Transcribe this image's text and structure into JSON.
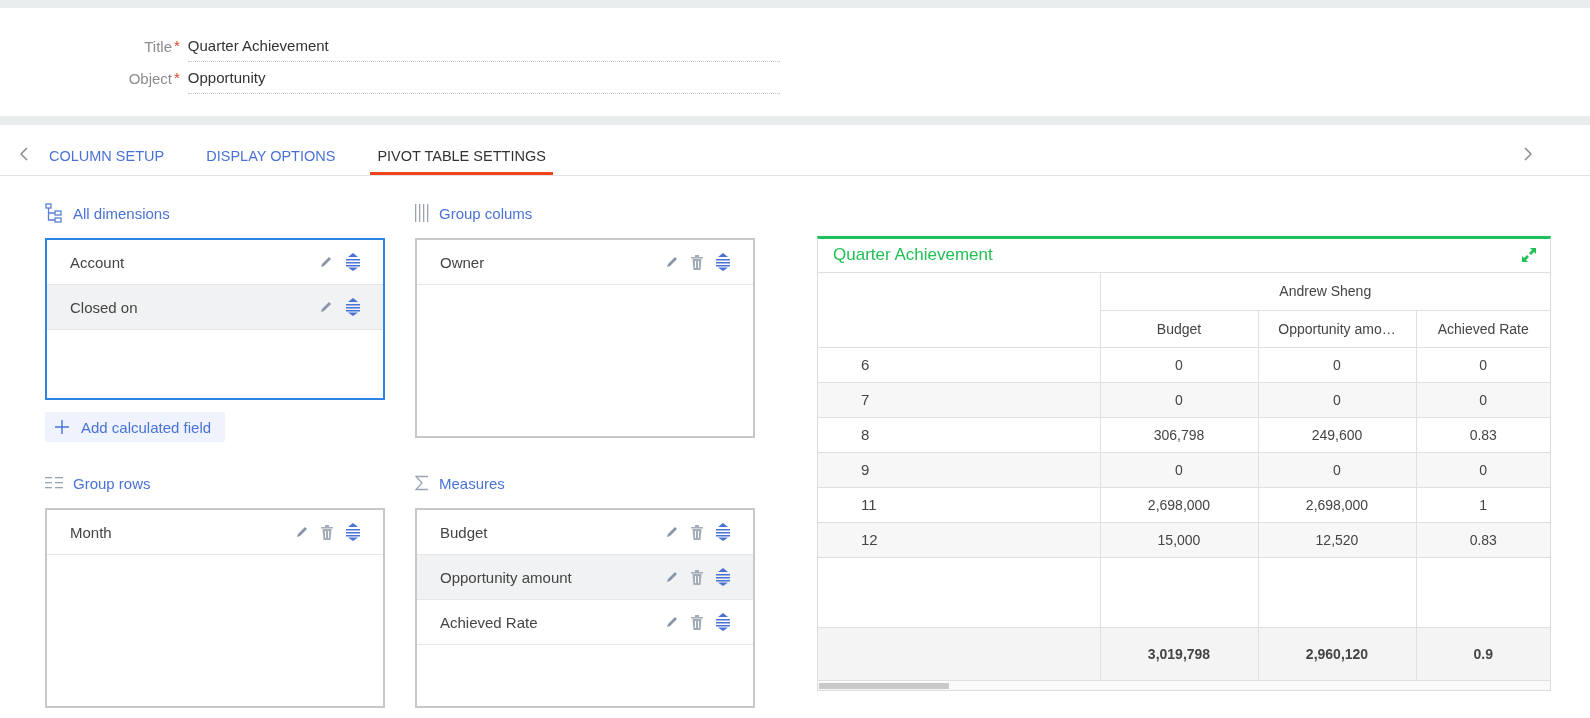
{
  "form": {
    "fields": [
      {
        "label": "Title",
        "mark": "*",
        "value": "Quarter Achievement"
      },
      {
        "label": "Object",
        "mark": "*",
        "value": "Opportunity"
      }
    ]
  },
  "tabs": [
    {
      "label": "COLUMN SETUP",
      "selected": false
    },
    {
      "label": "DISPLAY OPTIONS",
      "selected": false
    },
    {
      "label": "PIVOT TABLE SETTINGS",
      "selected": true
    }
  ],
  "sections": [
    {
      "kind": "dimensions",
      "title": "All dimensions",
      "focused": true,
      "removable": false,
      "items": [
        {
          "label": "Account",
          "highlighted": false
        },
        {
          "label": "Closed on",
          "highlighted": true
        }
      ],
      "add_button": "Add calculated field"
    },
    {
      "kind": "columns",
      "title": "Group colums",
      "focused": false,
      "removable": true,
      "items": [
        {
          "label": "Owner",
          "highlighted": false
        }
      ]
    },
    {
      "kind": "rows",
      "title": "Group rows",
      "focused": false,
      "removable": true,
      "items": [
        {
          "label": "Month",
          "highlighted": false
        }
      ]
    },
    {
      "kind": "measures",
      "title": "Measures",
      "focused": false,
      "removable": true,
      "items": [
        {
          "label": "Budget",
          "highlighted": false
        },
        {
          "label": "Opportunity amount",
          "highlighted": true
        },
        {
          "label": "Achieved Rate",
          "highlighted": false
        }
      ]
    }
  ],
  "pivot": {
    "title": "Quarter Achievement",
    "column_group": "Andrew Sheng",
    "columns": [
      "Budget",
      "Opportunity amo…",
      "Achieved Rate"
    ],
    "rows": [
      {
        "label": "6",
        "cells": [
          "0",
          "0",
          "0"
        ]
      },
      {
        "label": "7",
        "cells": [
          "0",
          "0",
          "0"
        ]
      },
      {
        "label": "8",
        "cells": [
          "306,798",
          "249,600",
          "0.83"
        ]
      },
      {
        "label": "9",
        "cells": [
          "0",
          "0",
          "0"
        ]
      },
      {
        "label": "11",
        "cells": [
          "2,698,000",
          "2,698,000",
          "1"
        ]
      },
      {
        "label": "12",
        "cells": [
          "15,000",
          "12,520",
          "0.83"
        ]
      }
    ],
    "totals": [
      "3,019,798",
      "2,960,120",
      "0.9"
    ]
  }
}
